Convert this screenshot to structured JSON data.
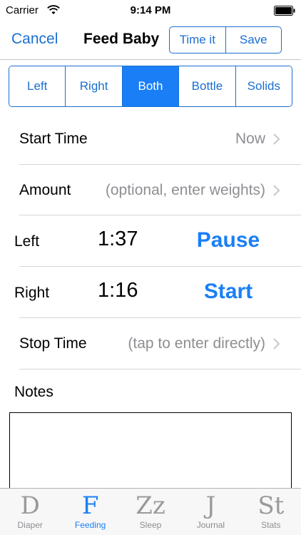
{
  "status_bar": {
    "carrier": "Carrier",
    "time": "9:14 PM"
  },
  "nav": {
    "cancel_label": "Cancel",
    "title": "Feed Baby",
    "time_it_label": "Time it",
    "save_label": "Save"
  },
  "feeding_types": {
    "options": [
      "Left",
      "Right",
      "Both",
      "Bottle",
      "Solids"
    ],
    "selected": "Both"
  },
  "start_time": {
    "label": "Start Time",
    "value": "Now"
  },
  "amount": {
    "label": "Amount",
    "value": "(optional, enter weights)"
  },
  "timers": [
    {
      "label": "Left",
      "time": "1:37",
      "action": "Pause"
    },
    {
      "label": "Right",
      "time": "1:16",
      "action": "Start"
    }
  ],
  "stop_time": {
    "label": "Stop Time",
    "value": "(tap to enter directly)"
  },
  "notes": {
    "label": "Notes",
    "value": ""
  },
  "tab_bar": {
    "active": "Feeding",
    "tabs": [
      {
        "icon_text": "D",
        "label": "Diaper"
      },
      {
        "icon_text": "F",
        "label": "Feeding"
      },
      {
        "icon_text": "Zz",
        "label": "Sleep"
      },
      {
        "icon_text": "J",
        "label": "Journal"
      },
      {
        "icon_text": "St",
        "label": "Stats"
      }
    ]
  },
  "colors": {
    "accent": "#1a7ff6",
    "nav_tint": "#1a6fd1",
    "secondary_text": "#8e8e93",
    "inactive_tab": "#9a9a9a"
  }
}
